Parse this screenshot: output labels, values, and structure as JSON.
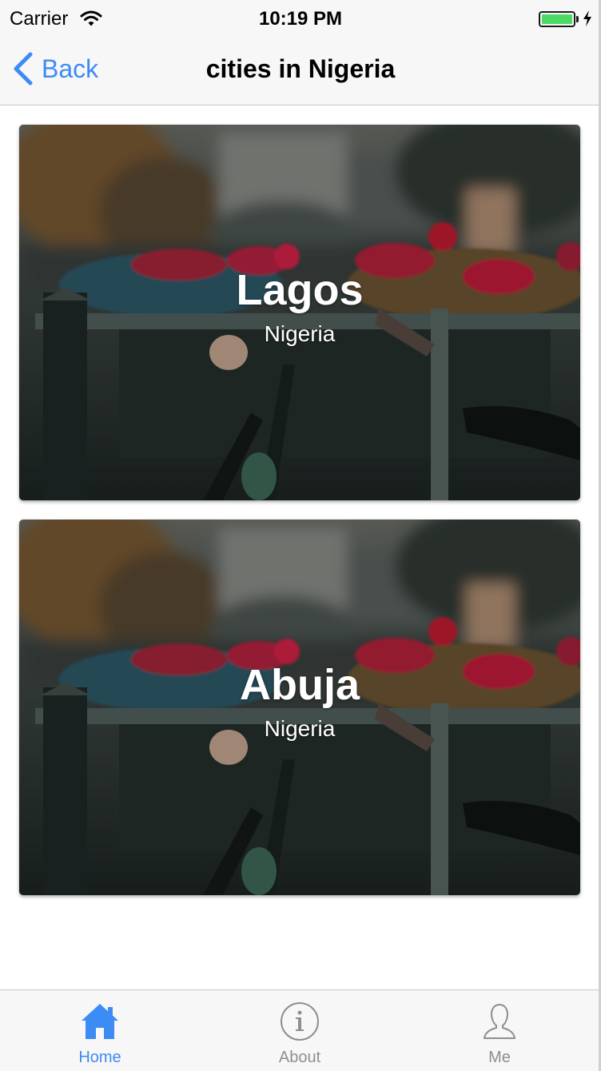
{
  "status_bar": {
    "carrier": "Carrier",
    "time": "10:19 PM",
    "battery_level": 1.0,
    "battery_color": "#4cd964",
    "icons": [
      "wifi-icon",
      "battery-icon",
      "charging-bolt-icon"
    ]
  },
  "nav": {
    "back_label": "Back",
    "back_icon": "chevron-left-icon",
    "title": "cities in Nigeria",
    "accent_color": "#3d8bf5"
  },
  "cards": [
    {
      "title": "Lagos",
      "subtitle": "Nigeria",
      "image": "canal-bridge-flowers-bicycle-photo"
    },
    {
      "title": "Abuja",
      "subtitle": "Nigeria",
      "image": "canal-bridge-flowers-bicycle-photo"
    }
  ],
  "tabs": [
    {
      "label": "Home",
      "icon": "house-icon",
      "active": true
    },
    {
      "label": "About",
      "icon": "info-circle-icon",
      "active": false
    },
    {
      "label": "Me",
      "icon": "person-icon",
      "active": false
    }
  ],
  "colors": {
    "active_tab": "#3d8bf5",
    "inactive_tab": "#8e8e93"
  }
}
